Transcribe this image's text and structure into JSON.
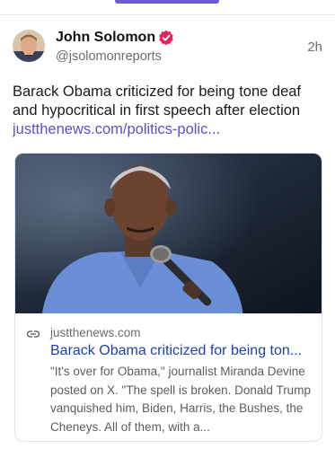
{
  "post": {
    "author_name": "John Solomon",
    "handle": "@jsolomonreports",
    "timestamp": "2h",
    "body": "Barack Obama criticized for being tone deaf and hypocritical in first speech after election",
    "link_text": "justthenews.com/politics-polic..."
  },
  "card": {
    "domain": "justthenews.com",
    "title": "Barack Obama criticized for being ton...",
    "description": "\"It's over for Obama,\" journalist Miranda Devine posted on X. \"The spell is broken. Donald Trump vanquished him, Biden, Harris, the Bushes, the Cheneys. All of them, with a..."
  },
  "colors": {
    "accent": "#6b5bd6",
    "link": "#5a4fcf",
    "verified": "#e0245e"
  },
  "icons": {
    "verified": "verified-badge-icon",
    "link": "link-icon"
  }
}
